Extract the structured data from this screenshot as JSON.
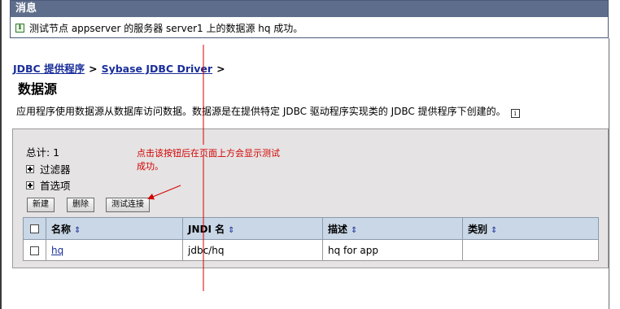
{
  "message": {
    "header": "消息",
    "icon": "info-icon",
    "text": "测试节点 appserver 的服务器 server1 上的数据源 hq 成功。"
  },
  "breadcrumb": {
    "items": [
      "JDBC 提供程序",
      "Sybase JDBC Driver"
    ],
    "separator": ">"
  },
  "page_title": "数据源",
  "description": "应用程序使用数据源从数据库访问数据。数据源是在提供特定 JDBC 驱动程序实现类的 JDBC 提供程序下创建的。",
  "panel": {
    "total": "总计: 1",
    "filter": "过滤器",
    "preferences": "首选项",
    "buttons": {
      "new": "新建",
      "delete": "删除",
      "test": "测试连接"
    }
  },
  "annotation": {
    "line1": "点击该按钮后在页面上方会显示测试",
    "line2": "成功。",
    "color": "#d40000"
  },
  "table": {
    "columns": [
      "名称",
      "JNDI 名",
      "描述",
      "类别"
    ],
    "rows": [
      {
        "name": "hq",
        "jndi": "jdbc/hq",
        "description": "hq for app",
        "category": ""
      }
    ]
  },
  "colors": {
    "message_header": "#5f6d8c",
    "link": "#1a2e9a",
    "panel_bg": "#e5e3e3",
    "table_header": "#c9d7e6"
  }
}
